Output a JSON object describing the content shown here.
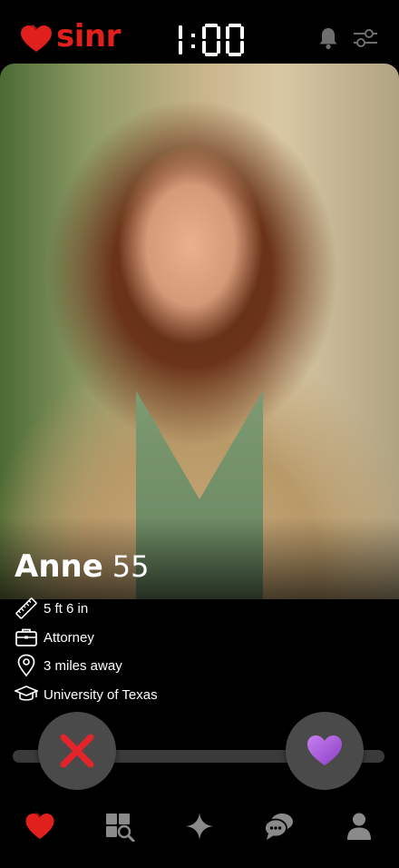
{
  "app": {
    "name": "sinr",
    "brand_color": "#e0201c"
  },
  "header": {
    "timer_digits": [
      "1",
      "0",
      "0"
    ],
    "timer_text": "1:00",
    "bell_icon": "bell-icon",
    "filters_icon": "sliders-icon"
  },
  "profile": {
    "name": "Anne",
    "age": "55",
    "height": "5 ft 6 in",
    "job": "Attorney",
    "distance": "3 miles away",
    "school": "University of Texas",
    "photo_description_icon": "profile-photo"
  },
  "actions": {
    "dislike_icon": "x-icon",
    "like_icon": "heart-icon",
    "dislike_color": "#e5232a",
    "like_color": "#9b4fd1"
  },
  "nav": {
    "items": [
      {
        "icon": "heart-icon",
        "active": true
      },
      {
        "icon": "explore-icon",
        "active": false
      },
      {
        "icon": "sparkle-icon",
        "active": false
      },
      {
        "icon": "chat-icon",
        "active": false
      },
      {
        "icon": "user-icon",
        "active": false
      }
    ]
  }
}
